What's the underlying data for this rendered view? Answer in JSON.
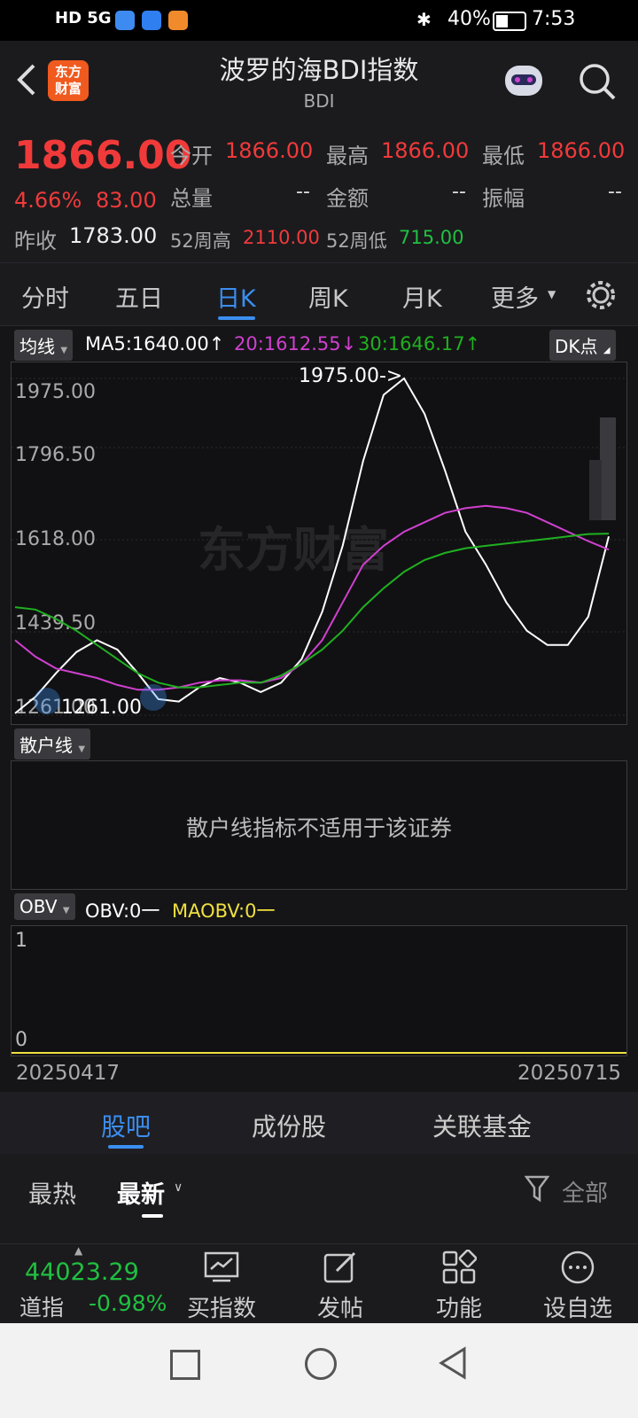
{
  "status": {
    "time": "7:53",
    "battery": "40%",
    "left_icons": "HD 5G"
  },
  "header": {
    "title": "波罗的海BDI指数",
    "subtitle": "BDI",
    "logo_text_1": "东方",
    "logo_text_2": "财富"
  },
  "quote": {
    "price": "1866.00",
    "change_pct": "4.66%",
    "change_val": "83.00",
    "prev_close_label": "昨收",
    "prev_close": "1783.00",
    "open_label": "今开",
    "open": "1866.00",
    "high_label": "最高",
    "high": "1866.00",
    "low_label": "最低",
    "low": "1866.00",
    "volume_label": "总量",
    "volume": "--",
    "amount_label": "金额",
    "amount": "--",
    "amplitude_label": "振幅",
    "amplitude": "--",
    "w52_high_label": "52周高",
    "w52_high": "2110.00",
    "w52_low_label": "52周低",
    "w52_low": "715.00"
  },
  "tabs": [
    "分时",
    "五日",
    "日K",
    "周K",
    "月K",
    "更多"
  ],
  "active_tab": "日K",
  "chart": {
    "ma_chip": "均线",
    "ma5": "MA5:1640.00",
    "ma20": "20:1612.55",
    "ma30": "30:1646.17",
    "dk_chip": "DK点",
    "y_labels": [
      "1975.00",
      "1796.50",
      "1618.00",
      "1439.50",
      "1261.00"
    ],
    "high_marker": "1975.00->",
    "low_marker": "1261.00",
    "watermark": "东方财富"
  },
  "chart_data": {
    "type": "line",
    "ylim": [
      1261,
      1975
    ],
    "series": [
      {
        "name": "MA5",
        "color": "#ffffff",
        "values": [
          1265,
          1300,
          1350,
          1395,
          1420,
          1400,
          1350,
          1295,
          1290,
          1320,
          1340,
          1330,
          1310,
          1330,
          1380,
          1480,
          1620,
          1800,
          1940,
          1975,
          1900,
          1780,
          1650,
          1580,
          1500,
          1440,
          1410,
          1410,
          1470,
          1640
        ]
      },
      {
        "name": "20",
        "color": "#d040d0",
        "values": [
          1420,
          1385,
          1360,
          1350,
          1340,
          1325,
          1315,
          1315,
          1320,
          1330,
          1335,
          1335,
          1330,
          1340,
          1370,
          1420,
          1500,
          1580,
          1620,
          1650,
          1670,
          1690,
          1700,
          1705,
          1700,
          1690,
          1670,
          1650,
          1630,
          1612
        ]
      },
      {
        "name": "30",
        "color": "#20b020",
        "values": [
          1490,
          1485,
          1465,
          1440,
          1410,
          1380,
          1350,
          1330,
          1320,
          1320,
          1325,
          1330,
          1330,
          1345,
          1370,
          1400,
          1440,
          1490,
          1530,
          1565,
          1590,
          1605,
          1615,
          1620,
          1625,
          1630,
          1635,
          1640,
          1645,
          1646
        ]
      }
    ]
  },
  "retail": {
    "chip": "散户线",
    "message": "散户线指标不适用于该证券"
  },
  "obv": {
    "chip": "OBV",
    "obv": "OBV:0一",
    "maobv": "MAOBV:0一",
    "y_top": "1",
    "y_bottom": "0"
  },
  "dates": {
    "start": "20250417",
    "end": "20250715"
  },
  "bottom_tabs": [
    "股吧",
    "成份股",
    "关联基金"
  ],
  "feed": {
    "hot": "最热",
    "new": "最新",
    "filter": "全部"
  },
  "bottom_bar": {
    "index_value": "44023.29",
    "index_name": "道指",
    "index_change": "-0.98%",
    "buttons": [
      "买指数",
      "发帖",
      "功能",
      "设自选"
    ]
  }
}
